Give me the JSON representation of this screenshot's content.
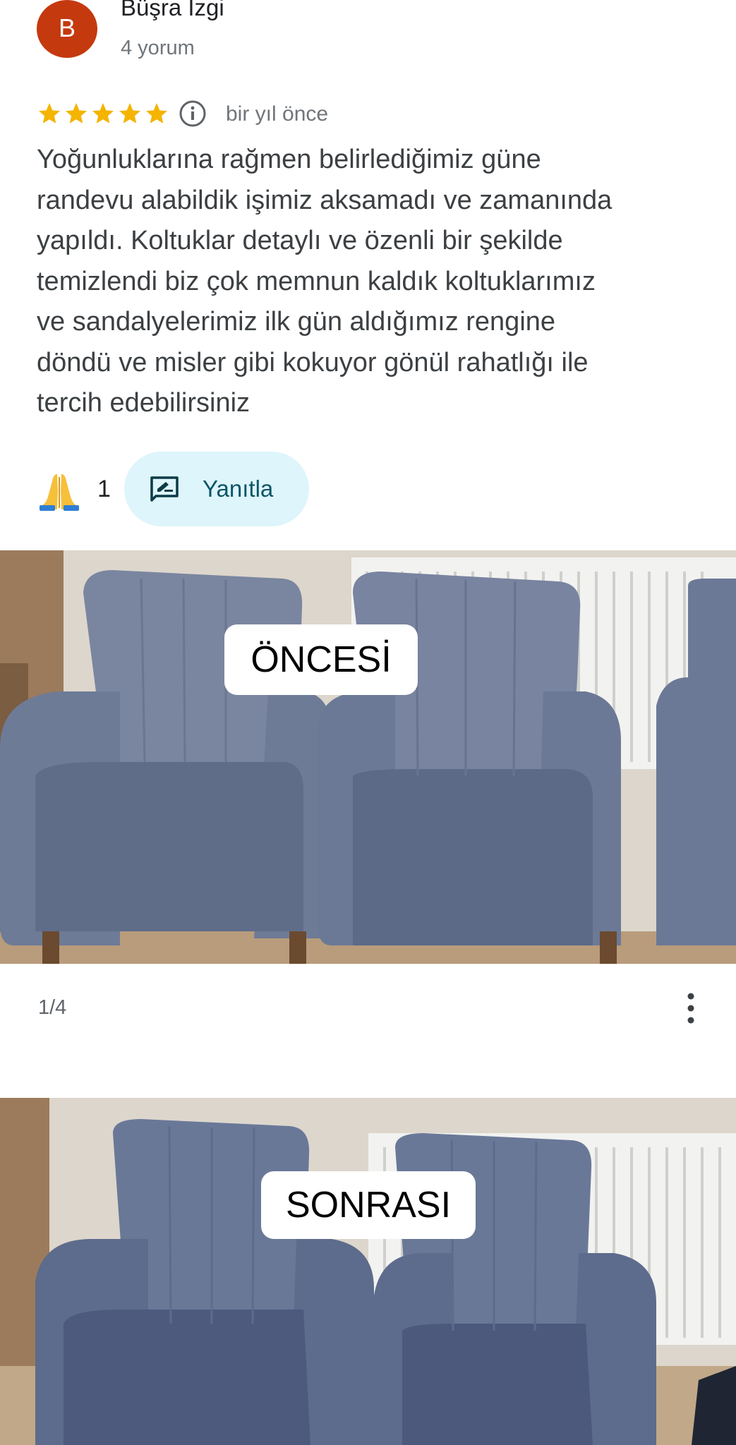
{
  "author": {
    "initial": "B",
    "name": "Büşra Izgi",
    "meta": "4 yorum",
    "avatar_color": "#c5390f"
  },
  "rating": {
    "stars": 5,
    "star_color": "#f4b400",
    "date": "bir yıl önce"
  },
  "review": {
    "lines": [
      "Yoğunluklarına rağmen belirlediğimiz güne",
      "randevu alabildik işimiz aksamadı ve zamanında",
      "yapıldı. Koltuklar detaylı ve özenli bir şekilde",
      "temizlendi biz çok memnun kaldık koltuklarımız",
      "ve sandalyelerimiz ilk gün aldığımız rengine",
      "döndü ve misler gibi kokuyor gönül rahatlığı ile",
      "tercih edebilirsiniz"
    ]
  },
  "actions": {
    "reaction_icon": "folded-hands-emoji",
    "reaction_count": "1",
    "reply_label": "Yanıtla",
    "reply_icon": "rate-review-icon"
  },
  "photos": [
    {
      "label": "ÖNCESİ",
      "description_icon": "armchairs-before-cleaning-photo"
    },
    {
      "label": "SONRASI",
      "description_icon": "armchairs-after-cleaning-photo"
    }
  ],
  "gallery": {
    "counter": "1/4",
    "more_icon": "more-vert-icon"
  }
}
